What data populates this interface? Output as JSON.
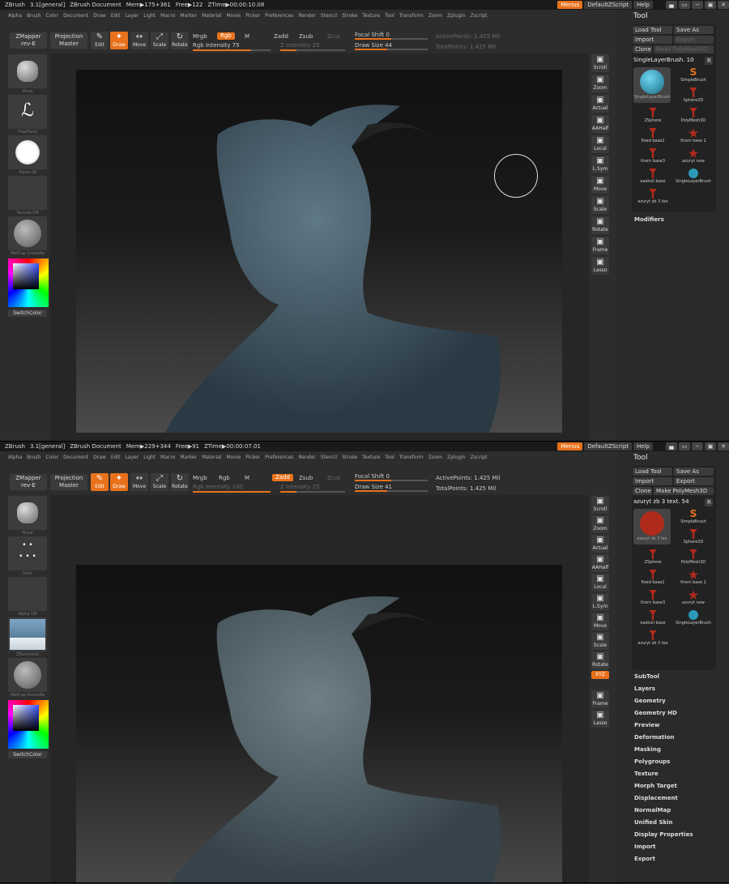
{
  "panes": [
    {
      "title": {
        "app": "ZBrush",
        "version": "3.1[general]",
        "doc": "ZBrush Document",
        "mem": "Mem▶175+361",
        "free": "Free▶122",
        "ztime": "ZTime▶00:00:10.08"
      },
      "topright": {
        "menus": "Menus",
        "script": "DefaultZScript",
        "help": "Help"
      },
      "menus": [
        "Alpha",
        "Brush",
        "Color",
        "Document",
        "Draw",
        "Edit",
        "Layer",
        "Light",
        "Macro",
        "Marker",
        "Material",
        "Movie",
        "Picker",
        "Preferences",
        "Render",
        "Stencil",
        "Stroke",
        "Texture",
        "Tool",
        "Transform",
        "Zoom",
        "Zplugin",
        "Zscript"
      ],
      "toolbar": {
        "zmapper": "ZMapper",
        "zmapper_sub": "rev-E",
        "projection": "Projection",
        "projection_sub": "Master",
        "edit": "Edit",
        "draw": "Draw",
        "move": "Move",
        "scale": "Scale",
        "rotate": "Rotate",
        "mrgb": "Mrgb",
        "rgb": "Rgb",
        "m": "M",
        "zadd": "Zadd",
        "zsub": "Zsub",
        "zcut": "Zcut",
        "rgb_intensity": "Rgb Intensity 75",
        "z_intensity": "Z Intensity 25",
        "focal_shift": "Focal Shift 0",
        "draw_size": "Draw Size 44",
        "active_points": "ActivePoints: 1.425 Mil",
        "total_points": "TotalPoints: 1.425 Mil"
      },
      "left": {
        "brush": "Move",
        "stroke": "FreeHand",
        "alpha": "Alpha 06",
        "texture": "Texture Off",
        "material": "MatCap GreenRe",
        "switch": "SwitchColor"
      },
      "right": [
        "Scroll",
        "Zoom",
        "Actual",
        "AAHalf",
        "Local",
        "L.Sym",
        "Move",
        "Scale",
        "Rotate",
        "Frame",
        "Lasso"
      ],
      "tool": {
        "title": "Tool",
        "load": "Load Tool",
        "save": "Save As",
        "import": "Import",
        "export": "Export",
        "clone": "Clone",
        "polymesh": "Make PolyMesh3D",
        "current": "SingleLayerBrush. 10",
        "r": "R",
        "big_label": "SingleLayerBrush",
        "items": [
          "SimpleBrush",
          "Sphere3D",
          "ZSphere",
          "PolyMesh3D",
          "fixed base2",
          "thorn base 2",
          "thorn base3",
          "azuryt new",
          "easkull base",
          "SingleLayerBrush",
          "azuryt zb 3 tex"
        ],
        "sections": [
          "Modifiers"
        ]
      }
    },
    {
      "title": {
        "app": "ZBrush",
        "version": "3.1[general]",
        "doc": "ZBrush Document",
        "mem": "Mem▶229+344",
        "free": "Free▶91",
        "ztime": "ZTime▶00:00:07.01"
      },
      "topright": {
        "menus": "Menus",
        "script": "DefaultZScript",
        "help": "Help"
      },
      "menus": [
        "Alpha",
        "Brush",
        "Color",
        "Document",
        "Draw",
        "Edit",
        "Layer",
        "Light",
        "Macro",
        "Marker",
        "Material",
        "Movie",
        "Picker",
        "Preferences",
        "Render",
        "Stencil",
        "Stroke",
        "Texture",
        "Tool",
        "Transform",
        "Zoom",
        "Zplugin",
        "Zscript"
      ],
      "toolbar": {
        "zmapper": "ZMapper",
        "zmapper_sub": "rev-E",
        "projection": "Projection",
        "projection_sub": "Master",
        "edit": "Edit",
        "draw": "Draw",
        "move": "Move",
        "scale": "Scale",
        "rotate": "Rotate",
        "mrgb": "Mrgb",
        "rgb": "Rgb",
        "m": "M",
        "zadd": "Zadd",
        "zsub": "Zsub",
        "zcut": "Zcut",
        "rgb_intensity": "Rgb Intensity 100",
        "z_intensity": "Z Intensity 25",
        "focal_shift": "Focal Shift 0",
        "draw_size": "Draw Size 41",
        "active_points": "ActivePoints: 1.425 Mil",
        "total_points": "TotalPoints: 1.425 Mil"
      },
      "left": {
        "brush": "Move",
        "stroke": "Dots",
        "alpha": "Alpha Off",
        "texture": "ZTexture02",
        "material": "MatCap GreenRe",
        "switch": "SwitchColor"
      },
      "right": [
        "Scroll",
        "Zoom",
        "Actual",
        "AAHalf",
        "Local",
        "L.Sym",
        "Move",
        "Scale",
        "Rotate",
        "XYZ",
        "Frame",
        "Lasso"
      ],
      "tool": {
        "title": "Tool",
        "load": "Load Tool",
        "save": "Save As",
        "import": "Import",
        "export": "Export",
        "clone": "Clone",
        "polymesh": "Make PolyMesh3D",
        "current": "azuryt zb 3 text. 54",
        "r": "R",
        "big_label": "azuryt zb 3 tex",
        "items": [
          "SimpleBrush",
          "Sphere3D",
          "ZSphere",
          "PolyMesh3D",
          "fixed base2",
          "thorn base 2",
          "thorn base3",
          "azuryt new",
          "easkull base",
          "SingleLayerBrush",
          "azuryt zb 3 tex"
        ],
        "sections": [
          "SubTool",
          "Layers",
          "Geometry",
          "Geometry HD",
          "Preview",
          "Deformation",
          "Masking",
          "Polygroups",
          "Texture",
          "Morph Target",
          "Displacement",
          "NormalMap",
          "Unified Skin",
          "Display Properties",
          "Import",
          "Export"
        ]
      }
    }
  ]
}
